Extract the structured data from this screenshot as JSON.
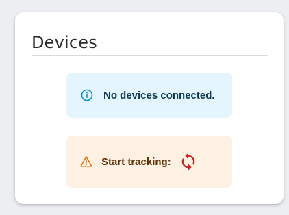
{
  "card": {
    "title": "Devices"
  },
  "alerts": {
    "info": {
      "icon": "info-icon",
      "message": "No devices connected.",
      "color": "#0288d1"
    },
    "warning": {
      "icon": "warning-icon",
      "message": "Start tracking:",
      "color": "#ed6c02",
      "action_icon": "sync-icon",
      "action_color": "#c62828"
    }
  }
}
